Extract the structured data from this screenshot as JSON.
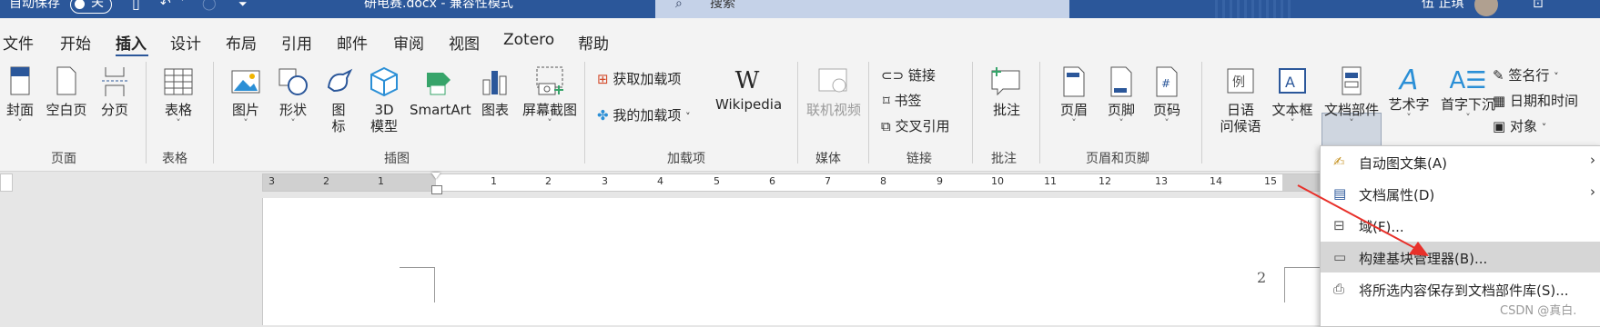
{
  "titlebar": {
    "autosave_label": "自动保存",
    "toggle_state": "关",
    "document_title": "研电赛.docx  -  兼容性模式",
    "search_placeholder": "搜索",
    "user_name": "伍 正琪"
  },
  "tabs": [
    "文件",
    "开始",
    "插入",
    "设计",
    "布局",
    "引用",
    "邮件",
    "审阅",
    "视图",
    "Zotero",
    "帮助"
  ],
  "active_tab": "插入",
  "ribbon": {
    "pages": {
      "cover": "封面",
      "blank": "空白页",
      "break": "分页",
      "group": "页面"
    },
    "tables": {
      "table": "表格",
      "group": "表格"
    },
    "illustrations": {
      "pictures": "图片",
      "shapes": "形状",
      "icons1": "图",
      "icons2": "标",
      "model1": "3D",
      "model2": "模型",
      "smartart": "SmartArt",
      "chart": "图表",
      "screenshot": "屏幕截图",
      "group": "插图"
    },
    "addins": {
      "get": "获取加载项",
      "my": "我的加载项",
      "wikipedia": "Wikipedia",
      "group": "加载项"
    },
    "media": {
      "online_video": "联机视频",
      "group": "媒体"
    },
    "links": {
      "link": "链接",
      "bookmark": "书签",
      "crossref": "交叉引用",
      "group": "链接"
    },
    "comments": {
      "comment": "批注",
      "group": "批注"
    },
    "header_footer": {
      "header": "页眉",
      "footer": "页脚",
      "page_number": "页码",
      "group": "页眉和页脚"
    },
    "text": {
      "greeting1": "日语",
      "greeting2": "问候语",
      "textbox": "文本框",
      "quickparts": "文档部件",
      "wordart": "艺术字",
      "dropcap": "首字下沉",
      "signature": "签名行",
      "datetime": "日期和时间",
      "object": "对象"
    }
  },
  "ruler": {
    "numbers": [
      "3",
      "2",
      "1",
      "1",
      "2",
      "3",
      "4",
      "5",
      "6",
      "7",
      "8",
      "9",
      "10",
      "11",
      "12",
      "13",
      "14",
      "15"
    ]
  },
  "page": {
    "page_number": "2"
  },
  "dropdown": {
    "items": [
      {
        "label": "自动图文集(A)",
        "submenu": true
      },
      {
        "label": "文档属性(D)",
        "submenu": true
      },
      {
        "label": "域(F)...",
        "submenu": false
      },
      {
        "label": "构建基块管理器(B)...",
        "submenu": false
      },
      {
        "label": "将所选内容保存到文档部件库(S)...",
        "submenu": false
      }
    ],
    "highlighted_index": 3
  },
  "watermark": "CSDN @真白.",
  "colors": {
    "accent": "#2b579a",
    "arrow": "#e8302a"
  }
}
